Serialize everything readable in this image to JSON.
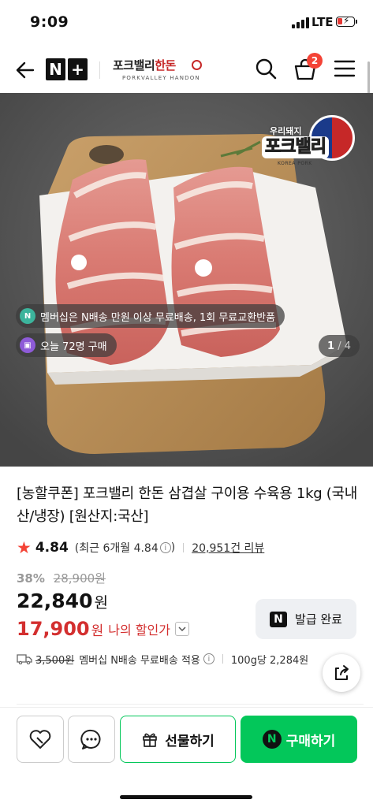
{
  "status_bar": {
    "time": "9:09",
    "network": "LTE"
  },
  "header": {
    "nplus_logo": "N+",
    "brand_name_a": "포크밸리",
    "brand_name_b": "한돈",
    "brand_sub": "PORKVALLEY HANDON",
    "cart_count": "2"
  },
  "hero": {
    "badge_top": "우리돼지",
    "badge_main": "포크밸리",
    "badge_en": "KOREA PORK",
    "membership_text": "멤버십은 N배송 만원 이상 무료배송, 1회 무료교환반품",
    "membership_icon": "N",
    "buyers_text": "오늘 72명 구매",
    "pager_current": "1",
    "pager_total": "/ 4"
  },
  "product": {
    "title": "[농할쿠폰] 포크밸리 한돈 삼겹살 구이용 수육용 1kg (국내산/냉장) [원산지:국산]",
    "rating": "4.84",
    "rating_detail_prefix": "(최근 6개월 4.84",
    "rating_detail_suffix": ")",
    "review_count": "20,951건 리뷰",
    "discount_rate": "38%",
    "original_price": "28,900원",
    "price": "22,840",
    "price_unit": "원",
    "my_price": "17,900",
    "my_price_unit": "원",
    "my_price_label": "나의 할인가",
    "coupon_label": "발급 완료",
    "shipping_fee": "3,500원",
    "shipping_text": "멤버십 N배송 무료배송 적용",
    "unit_price": "100g당 2,284원"
  },
  "bottom_bar": {
    "gift_label": "선물하기",
    "buy_label": "구매하기"
  },
  "colors": {
    "accent_green": "#03c75a",
    "sale_red": "#d32f2f",
    "badge_red": "#f44336"
  }
}
